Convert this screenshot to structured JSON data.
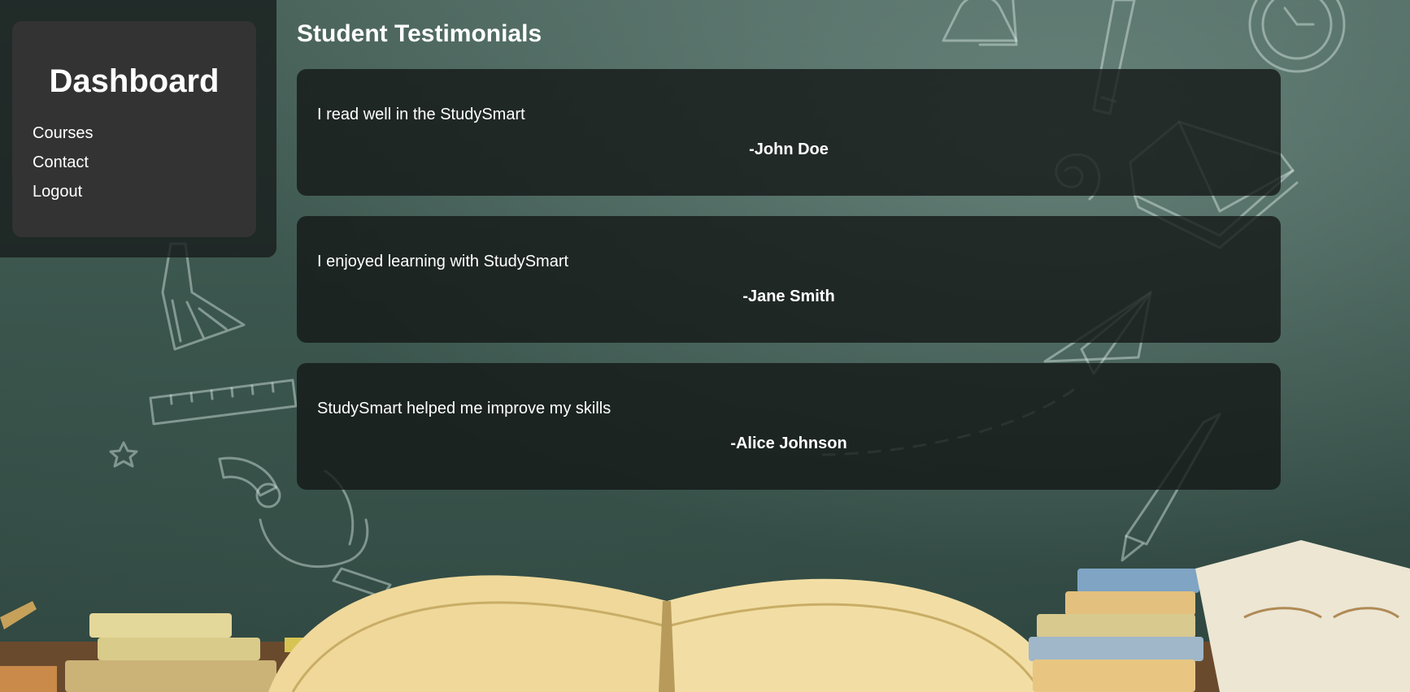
{
  "sidebar": {
    "title": "Dashboard",
    "items": [
      {
        "label": "Courses"
      },
      {
        "label": "Contact"
      },
      {
        "label": "Logout"
      }
    ]
  },
  "main": {
    "title": "Student Testimonials",
    "testimonials": [
      {
        "quote": "I read well in the StudySmart",
        "author": "-John Doe"
      },
      {
        "quote": "I enjoyed learning with StudySmart",
        "author": "-Jane Smith"
      },
      {
        "quote": "StudySmart helped me improve my skills",
        "author": "-Alice Johnson"
      }
    ]
  },
  "colors": {
    "chalkboard": "#3a544c",
    "panel": "#333333",
    "card": "#141817",
    "text": "#ffffff"
  }
}
